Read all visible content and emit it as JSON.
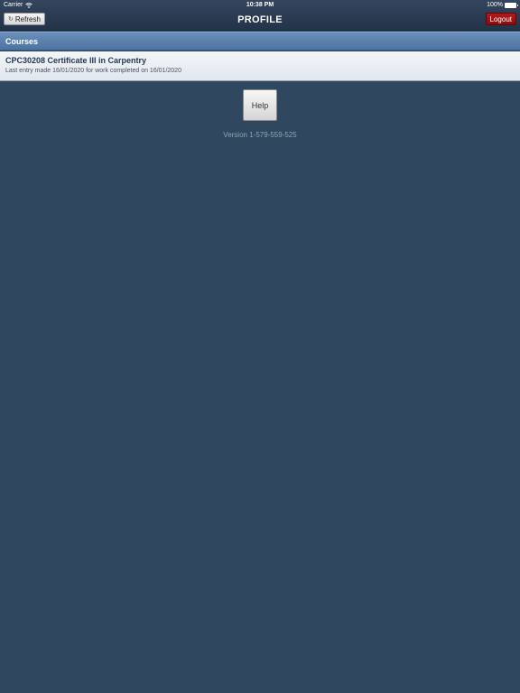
{
  "status_bar": {
    "carrier": "Carrier",
    "time": "10:38 PM",
    "battery": "100%"
  },
  "nav": {
    "refresh_label": "Refresh",
    "title": "PROFILE",
    "logout_label": "Logout"
  },
  "courses": {
    "header": "Courses",
    "items": [
      {
        "name": "CPC30208 Certificate III in Carpentry",
        "detail": "Last entry made 16/01/2020 for work completed on 16/01/2020"
      }
    ]
  },
  "help_label": "Help",
  "version": "Version 1-579-559-525",
  "icons": {
    "wifi": "wifi-icon",
    "battery": "battery-icon",
    "refresh": "refresh-icon"
  },
  "colors": {
    "background": "#304760",
    "section_header": "#5a80b0",
    "logout": "#9c1212"
  }
}
